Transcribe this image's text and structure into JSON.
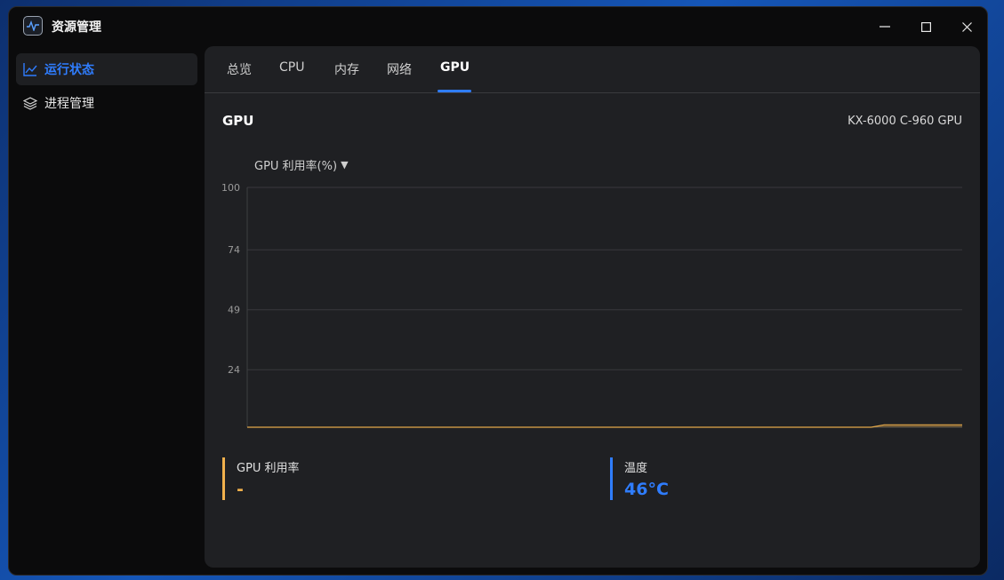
{
  "app": {
    "title": "资源管理",
    "icon": "pulse-icon"
  },
  "window_controls": {
    "minimize": "—",
    "maximize": "☐",
    "close": "✕"
  },
  "sidebar": {
    "items": [
      {
        "label": "运行状态",
        "icon": "line-chart-icon",
        "active": true
      },
      {
        "label": "进程管理",
        "icon": "layers-icon",
        "active": false
      }
    ]
  },
  "tabs": [
    {
      "label": "总览"
    },
    {
      "label": "CPU"
    },
    {
      "label": "内存"
    },
    {
      "label": "网络"
    },
    {
      "label": "GPU",
      "active": true
    }
  ],
  "section": {
    "title": "GPU",
    "device_name": "KX-6000 C-960 GPU"
  },
  "metric_selector": {
    "label": "GPU 利用率(%)"
  },
  "chart_data": {
    "type": "area",
    "ylim": [
      0,
      100
    ],
    "yticks": [
      "100",
      "74",
      "49",
      "24"
    ],
    "ytick_values": [
      100,
      74,
      49,
      24
    ],
    "grid": true,
    "series": [
      {
        "values": [
          0,
          0,
          0,
          0,
          0,
          0,
          0,
          0,
          0,
          0,
          0,
          0,
          0,
          0,
          0,
          0,
          0,
          0,
          0,
          0,
          0,
          0,
          0,
          0,
          0,
          0,
          0,
          0,
          0,
          0,
          0,
          0,
          0,
          0,
          0,
          0,
          0,
          0,
          0,
          0,
          0,
          0,
          0,
          0,
          0,
          0,
          0,
          0,
          0,
          1,
          1,
          1,
          1,
          1,
          1,
          1
        ],
        "color": "#e3a84a"
      }
    ]
  },
  "stats": [
    {
      "label": "GPU 利用率",
      "value": "-",
      "color": "#f0b04c"
    },
    {
      "label": "温度",
      "value": "46°C",
      "color": "#2f7dff"
    }
  ]
}
